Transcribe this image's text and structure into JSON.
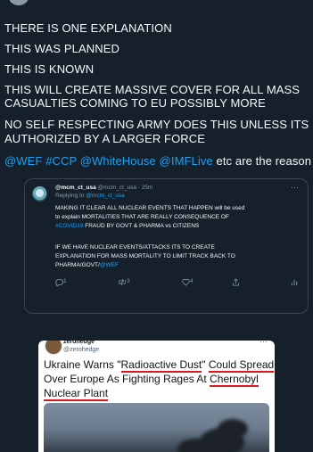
{
  "tweet": {
    "lines": [
      "THERE IS ONE EXPLANATION",
      "THIS WAS PLANNED",
      "THIS IS KNOWN",
      "THIS WILL CREATE MASSIVE COVER FOR ALL MASS",
      "CASUALTIES COMING TO EU POSSIBLY MORE",
      "NO SELF RESPECTING ARMY DOES THIS UNLESS ITS",
      "AUTHORIZED BY A LARGER FORCE"
    ],
    "last_line_mentions": "@WEF #CCP @WhiteHouse @IMFLive",
    "last_line_rest": " etc are the reason"
  },
  "quoted": {
    "name": "@mcm_ct_usa",
    "meta": " @mcm_ct_usa · 25m",
    "more": "···",
    "reply_label": "Replying to ",
    "reply_handle": "@mcm_ct_usa",
    "p1_l1": "MAKING IT CLEAR ALL NUCLEAR EVENTS THAT HAPPEN will be used",
    "p1_l2": "to explain MORTALITIES THAT ARE REALLY  CONSEQUENCE OF",
    "p1_l3_tag": "#COVID19",
    "p1_l3_rest": " FRAUD BY GOVT & PHARMA  vs CITIZENS",
    "p2_l1": "IF WE HAVE NUCLEAR EVENTS/ATTACKS ITS TO CREATE",
    "p2_l2": "EXPLANATION FOR MASS MORTALITY TO LIMIT TRACK BACK TO",
    "p2_l3": "PHARMA/GOVT/",
    "p2_l3_tag": "@WEF",
    "replies": "1",
    "retweets": "3",
    "likes": "4"
  },
  "card": {
    "name": "zerohedge",
    "handle": "@zerohedge",
    "more": "···",
    "h1_a": "Ukraine Warns \"",
    "h1_u1": "Radioactive Dust",
    "h1_b": "\" ",
    "h1_u2": "Could Spread",
    "h2_a": "Over Europe As Fighting Rages At ",
    "h2_u": "Chernobyl",
    "h3_u": "Nuclear Plant"
  },
  "colors": {
    "background": "#15202b",
    "link": "#1da1f2",
    "underline": "#e0161d"
  }
}
